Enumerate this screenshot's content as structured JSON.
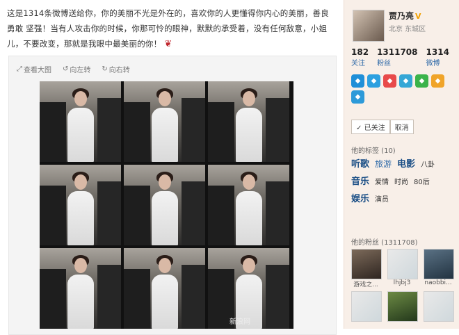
{
  "post": {
    "text": "这是1314条微博送给你，你的美丽不光是外在的，喜欢你的人更懂得你内心的美丽，善良 勇敢 坚强！当有人攻击你的时候，你那可怜的眼神，默默的承受着，没有任何敌意，小姐儿，不要改变，那就是我眼中最美丽的你！",
    "rose_icon": "rose-icon"
  },
  "media": {
    "toolbar": [
      "查看大图",
      "向左转",
      "向右转"
    ],
    "watermark": "新浪网"
  },
  "profile": {
    "name": "贾乃亮",
    "verified": "V",
    "location": "北京 东城区",
    "stats": [
      {
        "num": "182",
        "label": "关注"
      },
      {
        "num": "1311708",
        "label": "粉丝"
      },
      {
        "num": "1314",
        "label": "微博"
      }
    ],
    "follow_state": "已关注",
    "cancel_label": "取消",
    "badge_colors": [
      "#1f8fd8",
      "#2da0e0",
      "#e84a4a",
      "#35a7d6",
      "#3bb34a",
      "#f0a429",
      "#2d9ad9"
    ]
  },
  "tags_section": {
    "title": "他的标签 (10)",
    "rows": [
      [
        {
          "t": "听歌",
          "s": "lg"
        },
        {
          "t": "旅游",
          "s": "md"
        },
        {
          "t": "电影",
          "s": "lg"
        },
        {
          "t": "八卦",
          "s": "sm"
        }
      ],
      [
        {
          "t": "音乐",
          "s": "lg"
        },
        {
          "t": "爱情",
          "s": "sm"
        },
        {
          "t": "时尚",
          "s": "sm"
        },
        {
          "t": "80后",
          "s": "sm"
        }
      ],
      [
        {
          "t": "娱乐",
          "s": "lg"
        },
        {
          "t": "演员",
          "s": "sm"
        }
      ]
    ]
  },
  "fans_section": {
    "title": "他的粉丝 (1311708)",
    "fans": [
      {
        "name": "游戏之...",
        "style": "photo1"
      },
      {
        "name": "lhjbj3",
        "style": "face"
      },
      {
        "name": "naobbi...",
        "style": "photo2"
      },
      {
        "name": "",
        "style": "face"
      },
      {
        "name": "",
        "style": "photo3"
      },
      {
        "name": "",
        "style": "face"
      }
    ]
  }
}
